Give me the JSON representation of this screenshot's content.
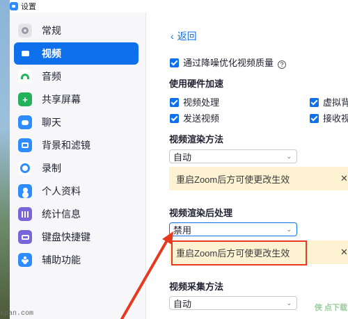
{
  "window": {
    "title": "设置"
  },
  "sidebar": {
    "items": [
      {
        "label": "常规",
        "icon": "gear-icon"
      },
      {
        "label": "视频",
        "icon": "video-camera-icon",
        "active": true
      },
      {
        "label": "音频",
        "icon": "headphones-icon"
      },
      {
        "label": "共享屏幕",
        "icon": "share-screen-icon",
        "glyph": "+"
      },
      {
        "label": "聊天",
        "icon": "chat-bubble-icon"
      },
      {
        "label": "背景和滤镜",
        "icon": "background-icon"
      },
      {
        "label": "录制",
        "icon": "record-icon"
      },
      {
        "label": "个人资料",
        "icon": "profile-icon"
      },
      {
        "label": "统计信息",
        "icon": "statistics-icon"
      },
      {
        "label": "键盘快捷键",
        "icon": "keyboard-icon"
      },
      {
        "label": "辅助功能",
        "icon": "accessibility-icon"
      }
    ]
  },
  "content": {
    "back_chevron": "‹",
    "back_label": "返回",
    "noise_reduction_label": "通过降噪优化视频质量",
    "help_glyph": "?",
    "hw_accel_title": "使用硬件加速",
    "hw_video_processing": "视频处理",
    "hw_virtual_bg": "虚拟背",
    "hw_send_video": "发送视频",
    "hw_receive_video": "接收视",
    "render_method_title": "视频渲染方法",
    "render_method_value": "自动",
    "restart_notice": "重启Zoom后方可使更改生效",
    "post_processing_title": "视频渲染后处理",
    "post_processing_value": "禁用",
    "restart_notice_2": "重启Zoom后方可使更改生效",
    "capture_method_title": "视频采集方法",
    "capture_method_value": "自动",
    "caret": "⌄",
    "close_glyph": "✕"
  },
  "watermarks": {
    "left": "kpan.com",
    "right": "侠 点下载"
  },
  "colors": {
    "accent": "#0e71eb",
    "notice_bg": "#fdf3d3",
    "annotation": "#e53920"
  }
}
